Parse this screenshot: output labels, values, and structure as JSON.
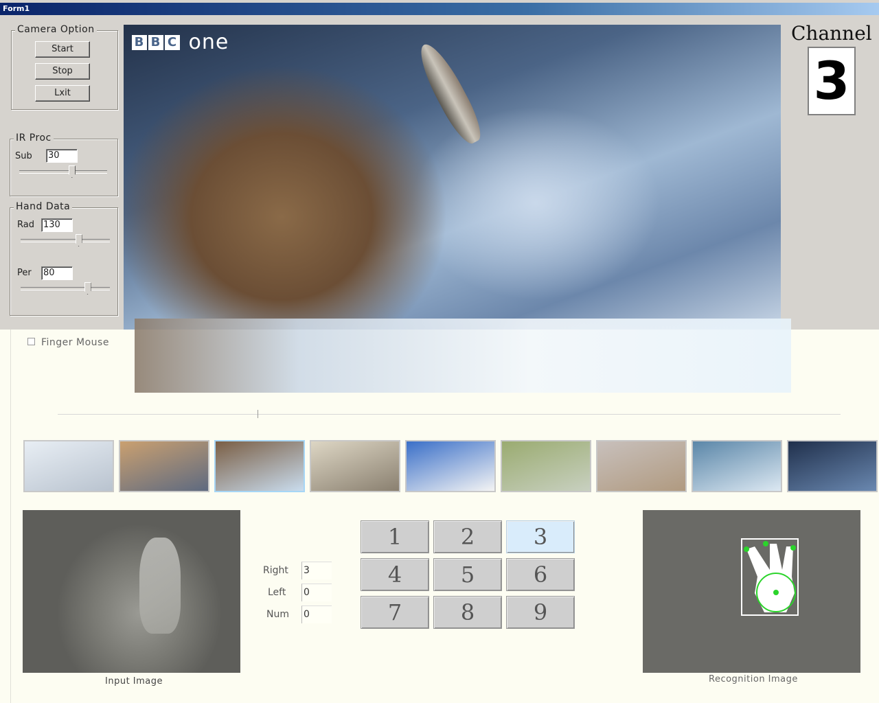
{
  "window": {
    "title": "Form1"
  },
  "camera": {
    "legend": "Camera Option",
    "start": "Start",
    "stop": "Stop",
    "exit": "Lxit"
  },
  "ir": {
    "legend": "IR Proc",
    "sub_label": "Sub",
    "sub_value": "30",
    "sub_slider": 0.6
  },
  "hand": {
    "legend": "Hand Data",
    "rad_label": "Rad",
    "rad_value": "130",
    "rad_slider": 0.65,
    "per_label": "Per",
    "per_value": "80",
    "per_slider": 0.75
  },
  "video": {
    "logo_boxes": [
      "B",
      "B",
      "C"
    ],
    "logo_word": "one"
  },
  "channel": {
    "title": "Channel",
    "number": "3"
  },
  "finger_mouse": {
    "label": "Finger Mouse",
    "checked": false
  },
  "thumbnails": [
    {
      "name": "snow",
      "colors": [
        "#e8eef4",
        "#b9c3cf"
      ]
    },
    {
      "name": "cliff",
      "colors": [
        "#caa070",
        "#5e6a80"
      ]
    },
    {
      "name": "bear-fish",
      "colors": [
        "#7a5e44",
        "#c9dcee"
      ],
      "selected": true
    },
    {
      "name": "porcupine",
      "colors": [
        "#ddd6c4",
        "#8a8070"
      ]
    },
    {
      "name": "clouds",
      "colors": [
        "#3a6fc8",
        "#f4f4f4"
      ]
    },
    {
      "name": "gazelle",
      "colors": [
        "#9aab70",
        "#c8d0c0"
      ]
    },
    {
      "name": "polar-bear",
      "colors": [
        "#c8c0bc",
        "#b09a80"
      ]
    },
    {
      "name": "sea",
      "colors": [
        "#5a86a8",
        "#dce8f2"
      ]
    },
    {
      "name": "night",
      "colors": [
        "#20304c",
        "#6a88b0"
      ]
    }
  ],
  "counts": {
    "right_label": "Right",
    "right_value": "3",
    "left_label": "Left",
    "left_value": "0",
    "num_label": "Num",
    "num_value": "0"
  },
  "keypad": {
    "keys": [
      "1",
      "2",
      "3",
      "4",
      "5",
      "6",
      "7",
      "8",
      "9"
    ],
    "active": "3"
  },
  "captions": {
    "input": "Input Image",
    "recognition": "Recognition Image"
  }
}
